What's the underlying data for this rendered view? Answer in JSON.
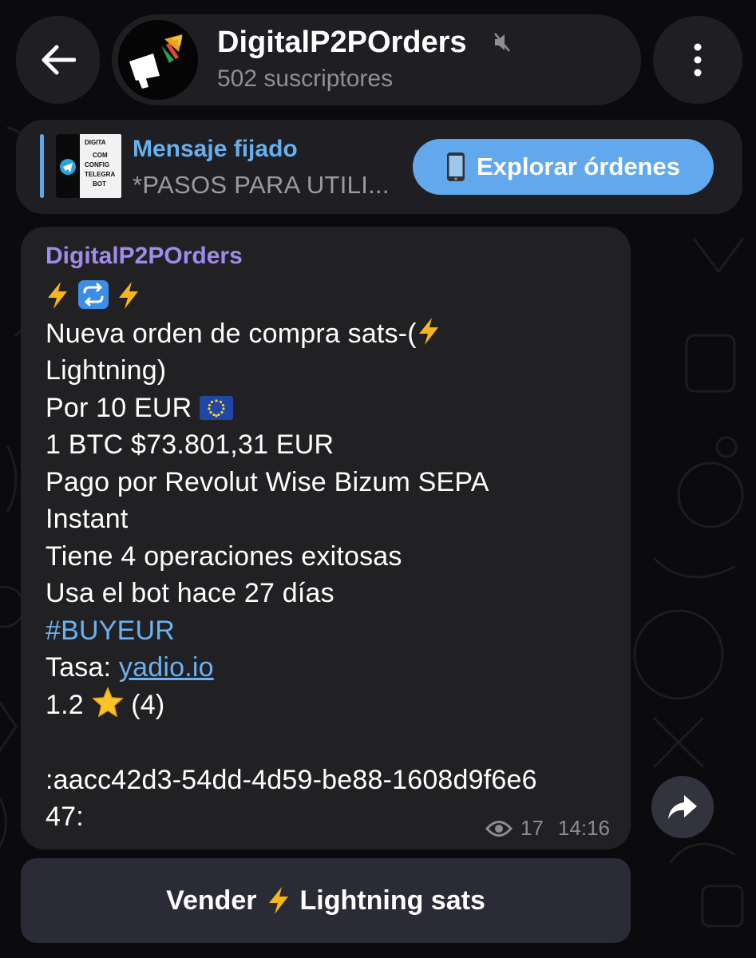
{
  "header": {
    "channel_name": "DigitalP2POrders",
    "subscribers": "502 suscriptores"
  },
  "pinned": {
    "title": "Mensaje fijado",
    "preview": "*PASOS PARA UTILI...",
    "thumb_lines": [
      "DIGITA",
      "COM",
      "CONFIG",
      "TELEGRA",
      "BOT"
    ],
    "button_label": "Explorar órdenes",
    "button_icon": "phone-icon"
  },
  "message": {
    "sender": "DigitalP2POrders",
    "line_1": "Nueva orden de compra sats-(",
    "line_1b": "Lightning)",
    "line_2": "Por 10 EUR",
    "line_3": "1 BTC $73.801,31 EUR",
    "line_4": "Pago por Revolut Wise Bizum SEPA",
    "line_4b": "Instant",
    "line_5": "Tiene 4 operaciones exitosas",
    "line_6": "Usa el bot hace 27 días",
    "hashtag": "#BUYEUR",
    "rate_label": "Tasa: ",
    "rate_link": "yadio.io",
    "rating_value": "1.2",
    "rating_count": "(4)",
    "order_id_1": ":aacc42d3-54dd-4d59-be88-1608d9f6e6",
    "order_id_2": "47:",
    "views": "17",
    "time": "14:16"
  },
  "keyboard": {
    "sell_prefix": "Vender",
    "sell_suffix": "Lightning sats"
  },
  "colors": {
    "accent": "#61a8ec",
    "sender": "#a18bea",
    "link": "#6ab2f2",
    "bubble": "#212124"
  }
}
